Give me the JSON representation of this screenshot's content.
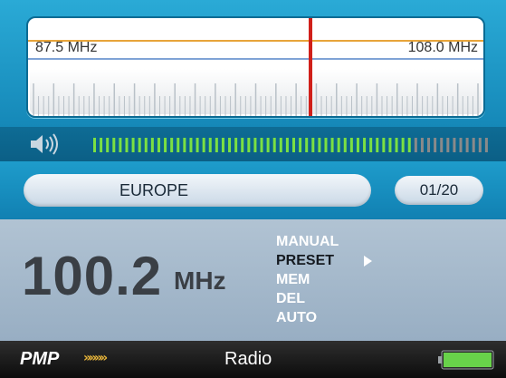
{
  "tuner": {
    "band_min_label": "87.5 MHz",
    "band_max_label": "108.0 MHz",
    "band_min_mhz": 87.5,
    "band_max_mhz": 108.0,
    "current_mhz": 100.2,
    "needle_color": "#d0201a"
  },
  "volume": {
    "level": 0.8,
    "active_color": "#7be042",
    "inactive_color": "#8a8a8a"
  },
  "region": {
    "label": "EUROPE"
  },
  "preset": {
    "label": "01/20"
  },
  "frequency": {
    "value": "100.2",
    "unit": "MHz"
  },
  "menu": {
    "items": [
      {
        "label": "MANUAL",
        "selected": false
      },
      {
        "label": "PRESET",
        "selected": true
      },
      {
        "label": "MEM",
        "selected": false
      },
      {
        "label": "DEL",
        "selected": false
      },
      {
        "label": "AUTO",
        "selected": false
      }
    ]
  },
  "status_bar": {
    "brand": "PMP",
    "brand_arrows": "»»»»",
    "title": "Radio",
    "battery_level": 1.0,
    "battery_color": "#68d24a"
  },
  "icons": {
    "speaker": "speaker-icon",
    "battery": "battery-icon",
    "selection_arrow": "arrow-right-icon"
  }
}
